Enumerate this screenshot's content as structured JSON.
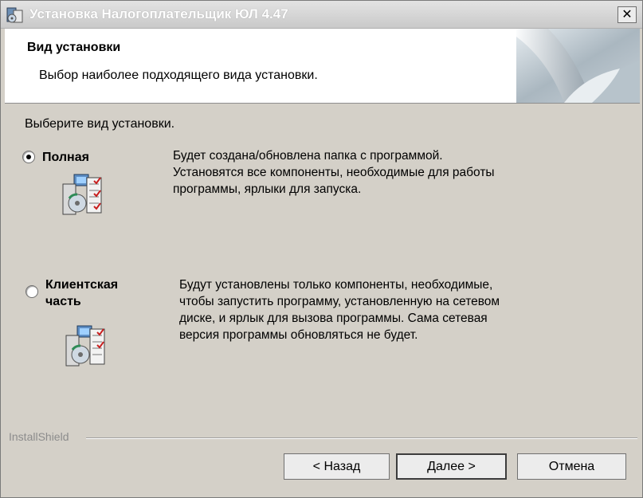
{
  "window": {
    "title": "Установка Налогоплательщик ЮЛ 4.47",
    "close_label": "✕"
  },
  "header": {
    "title": "Вид установки",
    "subtitle": "Выбор наиболее подходящего вида установки."
  },
  "prompt": "Выберите вид установки.",
  "options": [
    {
      "label_lines": [
        "Полная"
      ],
      "selected": true,
      "description_lines": [
        "Будет создана/обновлена папка с программой.",
        "Установятся все компоненты, необходимые для работы",
        "программы, ярлыки для запуска."
      ]
    },
    {
      "label_lines": [
        "Клиентская",
        "часть"
      ],
      "selected": false,
      "description_lines": [
        "Будут установлены только компоненты, необходимые,",
        "чтобы запустить программу, установленную на сетевом",
        "диске, и ярлык для вызова программы. Сама сетевая",
        "версия программы обновляться не будет."
      ]
    }
  ],
  "footer": {
    "brand": "InstallShield",
    "back_label": "< Назад",
    "next_label": "Далее >",
    "cancel_label": "Отмена"
  },
  "colors": {
    "window_bg": "#d4d0c8",
    "header_bg": "#ffffff",
    "brand_text": "#8c8c8c"
  },
  "icons": [
    "installer-app-icon",
    "close-icon",
    "setup-package-icon"
  ]
}
